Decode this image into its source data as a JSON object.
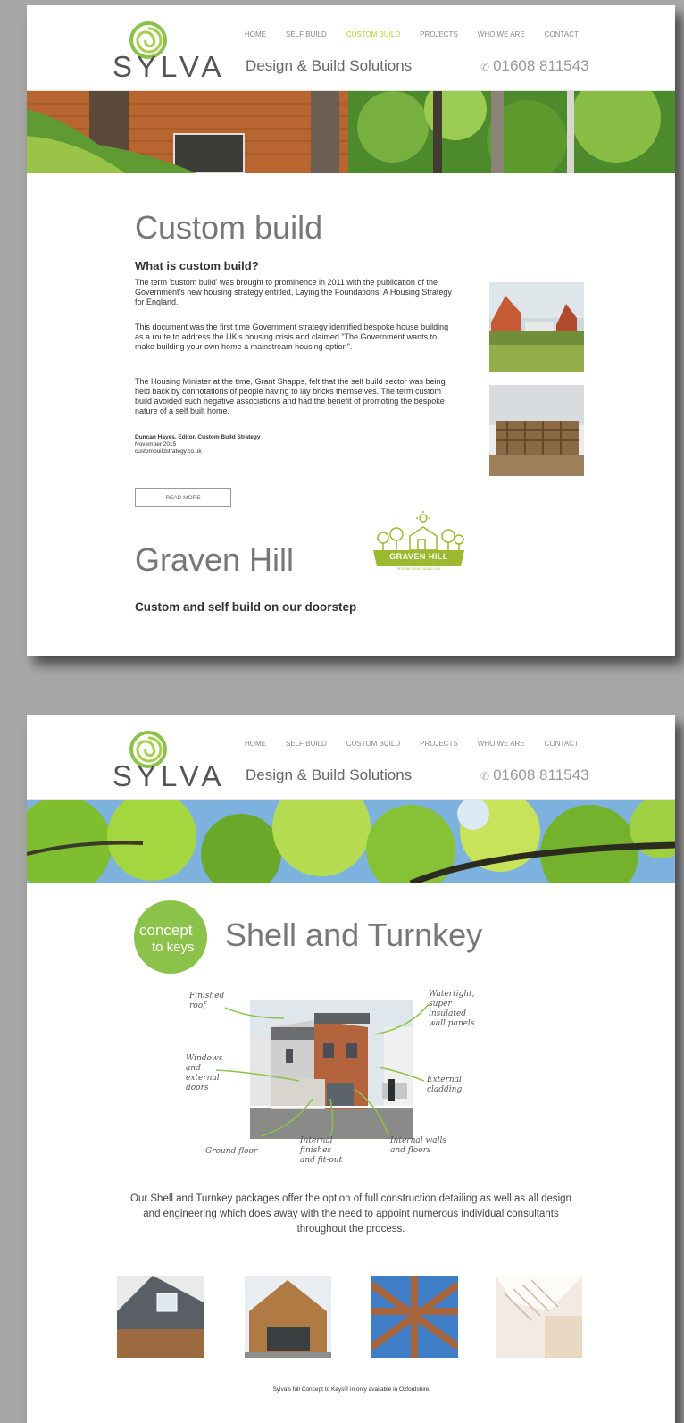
{
  "header": {
    "logo_text": "SYLVA",
    "tagline": "Design & Build Solutions",
    "phone": "01608 811543",
    "nav": [
      "HOME",
      "SELF BUILD",
      "CUSTOM BUILD",
      "PROJECTS",
      "WHO WE ARE",
      "CONTACT"
    ],
    "active_nav_page1": "CUSTOM BUILD"
  },
  "page1": {
    "title": "Custom build",
    "subtitle": "What is custom build?",
    "paragraphs": [
      "The term 'custom build' was brought to prominence in 2011 with the publication of the Government's new housing strategy entitled, Laying the Foundations: A Housing Strategy for England.",
      "This document was the first time Government strategy identified bespoke house building as a route to address the UK's housing crisis and claimed \"The Government wants to make building your own home a mainstream housing option\".",
      "The Housing Minister at the time, Grant Shapps, felt that the self build sector was being held back by connotations of people having to lay bricks themselves. The term custom build avoided such negative associations and had the benefit of promoting the bespoke nature of a self built home."
    ],
    "author": "Duncan Hayes, Editor, Custom Build Strategy",
    "date": "November 2015",
    "website": "custombuildstrategy.co.uk",
    "read_more": "READ MORE",
    "section2_title": "Graven Hill",
    "section2_subtitle": "Custom and self build on our doorstep",
    "graven_logo_text": "GRAVEN HILL",
    "graven_logo_small": "DESIGN CREATE BUILD LIVE"
  },
  "page2": {
    "badge_line1": "concept",
    "badge_line2": "to keys",
    "title": "Shell and Turnkey",
    "labels": {
      "finished_roof": "Finished\nroof",
      "watertight": "Watertight,\nsuper\ninsulated\nwall panels",
      "windows": "Windows\nand\nexternal\ndoors",
      "external_cladding": "External\ncladding",
      "ground_floor": "Ground floor",
      "internal_finishes": "Internal\nfinishes\nand fit-out",
      "internal_walls": "Internal walls\nand floors"
    },
    "description": "Our Shell and Turnkey packages offer the option of full construction detailing as well as all design and engineering which does away with the need to appoint numerous individual consultants throughout the process.",
    "footnote": "Sylva's full Concept to Keys® in only available in Oxfordshire"
  },
  "colors": {
    "brand_green": "#8bc34a",
    "nav_active": "#b4cf2e",
    "background": "#a7a7a7"
  }
}
